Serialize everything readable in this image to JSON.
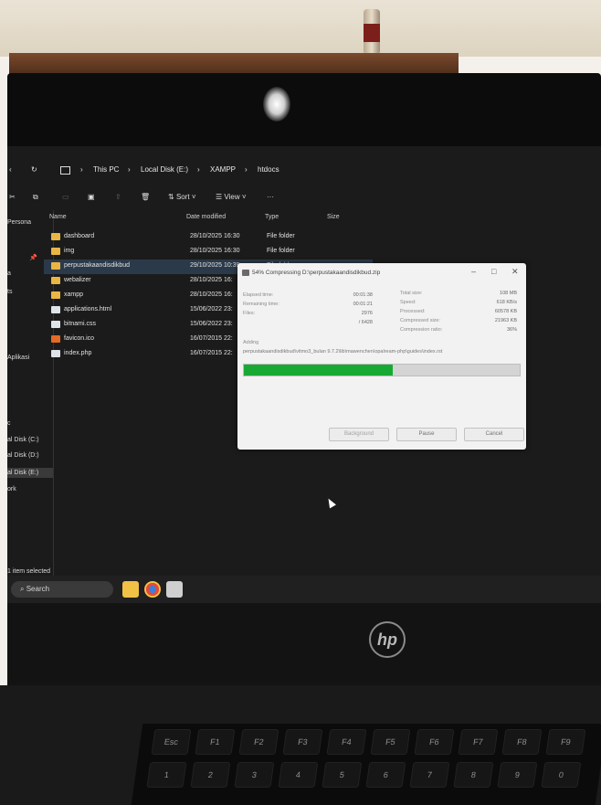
{
  "explorer": {
    "breadcrumbs": [
      "This PC",
      "Local Disk (E:)",
      "XAMPP",
      "htdocs"
    ],
    "toolbar": {
      "sort": "Sort",
      "view": "View",
      "more": "···"
    },
    "columns": {
      "name": "Name",
      "date": "Date modified",
      "type": "Type",
      "size": "Size"
    },
    "sidebar": {
      "top_label": "Persona",
      "aplikasi": "Aplikasi",
      "drives": [
        "al Disk (C:)",
        "al Disk (D:)",
        "al Disk (E:)"
      ],
      "network": "ork"
    },
    "files": [
      {
        "name": "dashboard",
        "date": "28/10/2025 16:30",
        "type": "File folder",
        "icon": "folder-icon"
      },
      {
        "name": "img",
        "date": "28/10/2025 16:30",
        "type": "File folder",
        "icon": "folder-icon"
      },
      {
        "name": "perpustakaandisdikbud",
        "date": "29/10/2025 10:39",
        "type": "File folder",
        "icon": "folder-icon"
      },
      {
        "name": "webalizer",
        "date": "28/10/2025 16:",
        "type": "",
        "icon": "folder-icon"
      },
      {
        "name": "xampp",
        "date": "28/10/2025 16:",
        "type": "",
        "icon": "folder-icon"
      },
      {
        "name": "applications.html",
        "date": "15/06/2022 23:",
        "type": "",
        "icon": "html-file-icon"
      },
      {
        "name": "bitnami.css",
        "date": "15/06/2022 23:",
        "type": "",
        "icon": "css-file-icon"
      },
      {
        "name": "favicon.ico",
        "date": "16/07/2015 22:",
        "type": "",
        "icon": "ico-file-icon"
      },
      {
        "name": "index.php",
        "date": "16/07/2015 22:",
        "type": "",
        "icon": "php-file-icon"
      }
    ],
    "status": "1 item selected",
    "taskbar": {
      "search": "Search"
    }
  },
  "dialog": {
    "title": "54% Compressing D:\\perpustakaandisdikbud.zip",
    "left_labels": [
      "Elapsed time:",
      "Remaining time:",
      "Files:"
    ],
    "left_values": [
      "00:01:38",
      "00:01:21",
      "2976"
    ],
    "files_total": "/ 6428",
    "right_labels": [
      "Total size:",
      "Speed:",
      "Processed:",
      "Compressed size:",
      "Compression ratio:"
    ],
    "right_values": [
      "108 MB",
      "618 KB/s",
      "60578 KB",
      "21963 KB",
      "36%"
    ],
    "adding_label": "Adding",
    "adding_path": "perpustakaandisdikbud\\vitmo3_bulan 9.7.2\\lib\\mawenchen\\opalream-php\\guides\\index.rst",
    "progress": 0.54,
    "buttons": {
      "background": "Background",
      "pause": "Pause",
      "cancel": "Cancel"
    }
  },
  "monitor": {
    "brand": "hp"
  },
  "keyboard": {
    "keys": [
      "Esc",
      "F1",
      "F2",
      "F3",
      "F4",
      "F5",
      "F6",
      "F7",
      "F8",
      "F9",
      "1",
      "2",
      "3",
      "4",
      "5",
      "6",
      "7",
      "8",
      "9",
      "0"
    ]
  }
}
